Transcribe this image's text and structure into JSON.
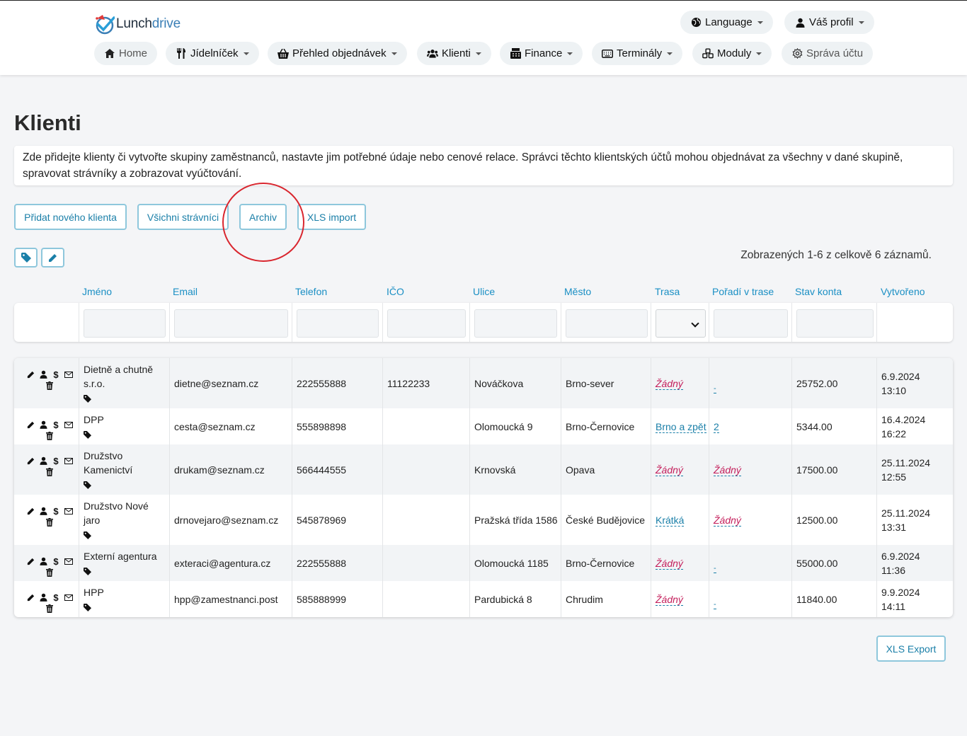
{
  "brand": {
    "name_part1": "Lunch",
    "name_part2": "drive"
  },
  "topbar": {
    "language": "Language",
    "profile": "Váš profil"
  },
  "nav": {
    "home": "Home",
    "menu": "Jídelníček",
    "orders": "Přehled objednávek",
    "clients": "Klienti",
    "finance": "Finance",
    "terminals": "Terminály",
    "modules": "Moduly",
    "account": "Správa účtu"
  },
  "page": {
    "title": "Klienti",
    "description": "Zde přidejte klienty či vytvořte skupiny zaměstnanců, nastavte jim potřebné údaje nebo cenové relace. Správci těchto klientských účtů mohou objednávat za všechny v dané skupině, spravovat strávníky a zobrazovat vyúčtování."
  },
  "actions": {
    "add_client": "Přidat nového klienta",
    "all_diners": "Všichni strávníci",
    "archive": "Archiv",
    "xls_import": "XLS import",
    "xls_export": "XLS Export"
  },
  "summary": "Zobrazených 1-6 z celkově 6 záznamů.",
  "columns": [
    "Jméno",
    "Email",
    "Telefon",
    "IČO",
    "Ulice",
    "Město",
    "Trasa",
    "Pořadí v trase",
    "Stav konta",
    "Vytvořeno"
  ],
  "rows": [
    {
      "name": "Dietně a chutně s.r.o.",
      "email": "dietne@seznam.cz",
      "phone": "222555888",
      "ico": "11122233",
      "street": "Nováčkova",
      "city": "Brno-sever",
      "route": "Žádný",
      "route_style": "none",
      "order": "-",
      "order_style": "dash",
      "balance": "25752.00",
      "created_date": "6.9.2024",
      "created_time": "13:10"
    },
    {
      "name": "DPP",
      "email": "cesta@seznam.cz",
      "phone": "555898898",
      "ico": "",
      "street": "Olomoucká 9",
      "city": "Brno-Černovice",
      "route": "Brno a zpět",
      "route_style": "link",
      "order": "2",
      "order_style": "link",
      "balance": "5344.00",
      "created_date": "16.4.2024",
      "created_time": "16:22"
    },
    {
      "name": "Družstvo Kamenictví",
      "email": "drukam@seznam.cz",
      "phone": "566444555",
      "ico": "",
      "street": "Krnovská",
      "city": "Opava",
      "route": "Žádný",
      "route_style": "none",
      "order": "Žádný",
      "order_style": "none",
      "balance": "17500.00",
      "created_date": "25.11.2024",
      "created_time": "12:55"
    },
    {
      "name": "Družstvo Nové jaro",
      "email": "drnovejaro@seznam.cz",
      "phone": "545878969",
      "ico": "",
      "street": "Pražská třída 1586",
      "city": "České Budějovice",
      "route": "Krátká",
      "route_style": "link",
      "order": "Žádný",
      "order_style": "none",
      "balance": "12500.00",
      "created_date": "25.11.2024",
      "created_time": "13:31"
    },
    {
      "name": "Externí agentura",
      "email": "exteraci@agentura.cz",
      "phone": "222555888",
      "ico": "",
      "street": "Olomoucká 1185",
      "city": "Brno-Černovice",
      "route": "Žádný",
      "route_style": "none",
      "order": "-",
      "order_style": "dash",
      "balance": "55000.00",
      "created_date": "6.9.2024",
      "created_time": "11:36"
    },
    {
      "name": "HPP",
      "email": "hpp@zamestnanci.post",
      "phone": "585888999",
      "ico": "",
      "street": "Pardubická 8",
      "city": "Chrudim",
      "route": "Žádný",
      "route_style": "none",
      "order": "-",
      "order_style": "dash",
      "balance": "11840.00",
      "created_date": "9.9.2024",
      "created_time": "14:11"
    }
  ],
  "colors": {
    "accent": "#1a8fc4",
    "button_border": "#8ec7dc",
    "annotation": "#d9262e",
    "none_link": "#c41e5b"
  }
}
